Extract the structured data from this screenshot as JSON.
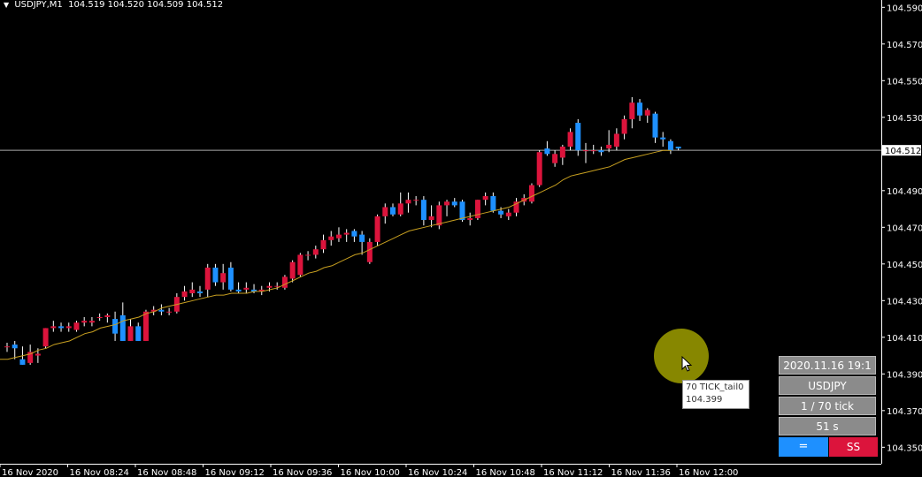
{
  "header": {
    "symbol": "USDJPY,M1",
    "ohlc": "104.519 104.520 104.509 104.512"
  },
  "colors": {
    "bull": "#dc143c",
    "bear": "#1e90ff",
    "wick": "#ffffff",
    "ma": "#c8a020",
    "grid": "#ffffff"
  },
  "current_price_label": "104.512",
  "tooltip": {
    "line1": "70 TICK_tail0",
    "line2": "104.399"
  },
  "panel": {
    "datetime": "2020.11.16 19:1",
    "symbol": "USDJPY",
    "ticks": "1 / 70 tick",
    "seconds": "51 s",
    "btn_equal": "=",
    "btn_ss": "SS"
  },
  "chart_data": {
    "type": "candlestick",
    "y_ticks": [
      "104.590",
      "104.570",
      "104.550",
      "104.530",
      "104.490",
      "104.470",
      "104.450",
      "104.430",
      "104.410",
      "104.390",
      "104.370",
      "104.350"
    ],
    "ylim": [
      104.341,
      104.594
    ],
    "x_ticks": [
      "16 Nov 2020",
      "16 Nov 08:24",
      "16 Nov 08:48",
      "16 Nov 09:12",
      "16 Nov 09:36",
      "16 Nov 10:00",
      "16 Nov 10:24",
      "16 Nov 10:48",
      "16 Nov 11:12",
      "16 Nov 11:36",
      "16 Nov 12:00"
    ],
    "current_price": 104.512,
    "candles": [
      {
        "o": 104.405,
        "h": 104.407,
        "l": 104.402,
        "c": 104.405
      },
      {
        "o": 104.406,
        "h": 104.408,
        "l": 104.398,
        "c": 104.404
      },
      {
        "o": 104.398,
        "h": 104.405,
        "l": 104.395,
        "c": 104.395
      },
      {
        "o": 104.396,
        "h": 104.406,
        "l": 104.395,
        "c": 104.402
      },
      {
        "o": 104.4,
        "h": 104.404,
        "l": 104.396,
        "c": 104.401
      },
      {
        "o": 104.405,
        "h": 104.415,
        "l": 104.404,
        "c": 104.415
      },
      {
        "o": 104.415,
        "h": 104.419,
        "l": 104.413,
        "c": 104.416
      },
      {
        "o": 104.416,
        "h": 104.418,
        "l": 104.413,
        "c": 104.415
      },
      {
        "o": 104.415,
        "h": 104.418,
        "l": 104.413,
        "c": 104.416
      },
      {
        "o": 104.414,
        "h": 104.419,
        "l": 104.413,
        "c": 104.418
      },
      {
        "o": 104.418,
        "h": 104.421,
        "l": 104.416,
        "c": 104.419
      },
      {
        "o": 104.418,
        "h": 104.421,
        "l": 104.416,
        "c": 104.419
      },
      {
        "o": 104.421,
        "h": 104.423,
        "l": 104.419,
        "c": 104.421
      },
      {
        "o": 104.421,
        "h": 104.423,
        "l": 104.418,
        "c": 104.422
      },
      {
        "o": 104.42,
        "h": 104.424,
        "l": 104.408,
        "c": 104.412
      },
      {
        "o": 104.422,
        "h": 104.429,
        "l": 104.408,
        "c": 104.408
      },
      {
        "o": 104.408,
        "h": 104.42,
        "l": 104.408,
        "c": 104.416
      },
      {
        "o": 104.416,
        "h": 104.418,
        "l": 104.408,
        "c": 104.408
      },
      {
        "o": 104.408,
        "h": 104.425,
        "l": 104.408,
        "c": 104.424
      },
      {
        "o": 104.424,
        "h": 104.427,
        "l": 104.422,
        "c": 104.425
      },
      {
        "o": 104.425,
        "h": 104.428,
        "l": 104.422,
        "c": 104.424
      },
      {
        "o": 104.424,
        "h": 104.426,
        "l": 104.422,
        "c": 104.424
      },
      {
        "o": 104.424,
        "h": 104.434,
        "l": 104.423,
        "c": 104.432
      },
      {
        "o": 104.432,
        "h": 104.438,
        "l": 104.43,
        "c": 104.435
      },
      {
        "o": 104.434,
        "h": 104.44,
        "l": 104.432,
        "c": 104.436
      },
      {
        "o": 104.435,
        "h": 104.438,
        "l": 104.432,
        "c": 104.434
      },
      {
        "o": 104.436,
        "h": 104.45,
        "l": 104.432,
        "c": 104.448
      },
      {
        "o": 104.448,
        "h": 104.45,
        "l": 104.438,
        "c": 104.44
      },
      {
        "o": 104.44,
        "h": 104.45,
        "l": 104.436,
        "c": 104.445
      },
      {
        "o": 104.448,
        "h": 104.451,
        "l": 104.435,
        "c": 104.436
      },
      {
        "o": 104.436,
        "h": 104.44,
        "l": 104.434,
        "c": 104.435
      },
      {
        "o": 104.436,
        "h": 104.44,
        "l": 104.434,
        "c": 104.437
      },
      {
        "o": 104.436,
        "h": 104.439,
        "l": 104.434,
        "c": 104.435
      },
      {
        "o": 104.435,
        "h": 104.438,
        "l": 104.433,
        "c": 104.436
      },
      {
        "o": 104.437,
        "h": 104.44,
        "l": 104.435,
        "c": 104.438
      },
      {
        "o": 104.438,
        "h": 104.44,
        "l": 104.436,
        "c": 104.438
      },
      {
        "o": 104.437,
        "h": 104.444,
        "l": 104.436,
        "c": 104.443
      },
      {
        "o": 104.442,
        "h": 104.452,
        "l": 104.44,
        "c": 104.451
      },
      {
        "o": 104.444,
        "h": 104.456,
        "l": 104.443,
        "c": 104.455
      },
      {
        "o": 104.455,
        "h": 104.457,
        "l": 104.452,
        "c": 104.455
      },
      {
        "o": 104.455,
        "h": 104.46,
        "l": 104.453,
        "c": 104.458
      },
      {
        "o": 104.458,
        "h": 104.466,
        "l": 104.456,
        "c": 104.463
      },
      {
        "o": 104.463,
        "h": 104.468,
        "l": 104.46,
        "c": 104.465
      },
      {
        "o": 104.464,
        "h": 104.47,
        "l": 104.462,
        "c": 104.466
      },
      {
        "o": 104.466,
        "h": 104.469,
        "l": 104.462,
        "c": 104.467
      },
      {
        "o": 104.468,
        "h": 104.469,
        "l": 104.462,
        "c": 104.465
      },
      {
        "o": 104.466,
        "h": 104.468,
        "l": 104.455,
        "c": 104.462
      },
      {
        "o": 104.451,
        "h": 104.464,
        "l": 104.45,
        "c": 104.462
      },
      {
        "o": 104.462,
        "h": 104.477,
        "l": 104.46,
        "c": 104.476
      },
      {
        "o": 104.476,
        "h": 104.483,
        "l": 104.472,
        "c": 104.481
      },
      {
        "o": 104.481,
        "h": 104.483,
        "l": 104.476,
        "c": 104.477
      },
      {
        "o": 104.477,
        "h": 104.489,
        "l": 104.476,
        "c": 104.483
      },
      {
        "o": 104.483,
        "h": 104.489,
        "l": 104.478,
        "c": 104.485
      },
      {
        "o": 104.485,
        "h": 104.487,
        "l": 104.482,
        "c": 104.485
      },
      {
        "o": 104.485,
        "h": 104.487,
        "l": 104.471,
        "c": 104.474
      },
      {
        "o": 104.474,
        "h": 104.482,
        "l": 104.47,
        "c": 104.476
      },
      {
        "o": 104.471,
        "h": 104.484,
        "l": 104.469,
        "c": 104.482
      },
      {
        "o": 104.482,
        "h": 104.485,
        "l": 104.476,
        "c": 104.484
      },
      {
        "o": 104.484,
        "h": 104.486,
        "l": 104.481,
        "c": 104.482
      },
      {
        "o": 104.484,
        "h": 104.485,
        "l": 104.473,
        "c": 104.474
      },
      {
        "o": 104.474,
        "h": 104.478,
        "l": 104.471,
        "c": 104.475
      },
      {
        "o": 104.475,
        "h": 104.485,
        "l": 104.474,
        "c": 104.485
      },
      {
        "o": 104.485,
        "h": 104.489,
        "l": 104.482,
        "c": 104.487
      },
      {
        "o": 104.487,
        "h": 104.489,
        "l": 104.478,
        "c": 104.479
      },
      {
        "o": 104.479,
        "h": 104.481,
        "l": 104.475,
        "c": 104.477
      },
      {
        "o": 104.476,
        "h": 104.48,
        "l": 104.474,
        "c": 104.478
      },
      {
        "o": 104.478,
        "h": 104.486,
        "l": 104.476,
        "c": 104.484
      },
      {
        "o": 104.484,
        "h": 104.488,
        "l": 104.482,
        "c": 104.486
      },
      {
        "o": 104.484,
        "h": 104.494,
        "l": 104.483,
        "c": 104.493
      },
      {
        "o": 104.493,
        "h": 104.512,
        "l": 104.492,
        "c": 104.511
      },
      {
        "o": 104.513,
        "h": 104.517,
        "l": 104.509,
        "c": 104.51
      },
      {
        "o": 104.505,
        "h": 104.512,
        "l": 104.503,
        "c": 104.51
      },
      {
        "o": 104.508,
        "h": 104.515,
        "l": 104.504,
        "c": 104.514
      },
      {
        "o": 104.514,
        "h": 104.524,
        "l": 104.512,
        "c": 104.522
      },
      {
        "o": 104.527,
        "h": 104.529,
        "l": 104.509,
        "c": 104.512
      },
      {
        "o": 104.512,
        "h": 104.516,
        "l": 104.505,
        "c": 104.512
      },
      {
        "o": 104.512,
        "h": 104.515,
        "l": 104.51,
        "c": 104.512
      },
      {
        "o": 104.512,
        "h": 104.514,
        "l": 104.509,
        "c": 104.511
      },
      {
        "o": 104.513,
        "h": 104.523,
        "l": 104.511,
        "c": 104.515
      },
      {
        "o": 104.514,
        "h": 104.524,
        "l": 104.512,
        "c": 104.521
      },
      {
        "o": 104.521,
        "h": 104.531,
        "l": 104.518,
        "c": 104.529
      },
      {
        "o": 104.529,
        "h": 104.541,
        "l": 104.524,
        "c": 104.538
      },
      {
        "o": 104.538,
        "h": 104.54,
        "l": 104.528,
        "c": 104.531
      },
      {
        "o": 104.531,
        "h": 104.535,
        "l": 104.527,
        "c": 104.534
      },
      {
        "o": 104.532,
        "h": 104.533,
        "l": 104.516,
        "c": 104.519
      },
      {
        "o": 104.519,
        "h": 104.522,
        "l": 104.514,
        "c": 104.518
      },
      {
        "o": 104.517,
        "h": 104.518,
        "l": 104.51,
        "c": 104.512
      },
      {
        "o": 104.514,
        "h": 104.514,
        "l": 104.512,
        "c": 104.513
      }
    ],
    "ma": [
      104.398,
      104.398,
      104.399,
      104.4,
      104.401,
      104.403,
      104.404,
      104.406,
      104.407,
      104.408,
      104.41,
      104.412,
      104.413,
      104.415,
      104.416,
      104.417,
      104.419,
      104.42,
      104.421,
      104.423,
      104.424,
      104.426,
      104.427,
      104.428,
      104.429,
      104.43,
      104.431,
      104.432,
      104.433,
      104.433,
      104.434,
      104.434,
      104.434,
      104.435,
      104.435,
      104.436,
      104.437,
      104.439,
      104.441,
      104.443,
      104.445,
      104.446,
      104.448,
      104.449,
      104.451,
      104.453,
      104.455,
      104.456,
      104.458,
      104.46,
      104.462,
      104.464,
      104.466,
      104.468,
      104.469,
      104.47,
      104.471,
      104.472,
      104.473,
      104.474,
      104.475,
      104.476,
      104.477,
      104.478,
      104.479,
      104.48,
      104.481,
      104.483,
      104.485,
      104.487,
      104.489,
      104.491,
      104.493,
      104.496,
      104.498,
      104.499,
      104.5,
      104.501,
      104.502,
      104.503,
      104.505,
      104.507,
      104.508,
      104.509,
      104.51,
      104.511,
      104.512,
      104.512
    ]
  }
}
